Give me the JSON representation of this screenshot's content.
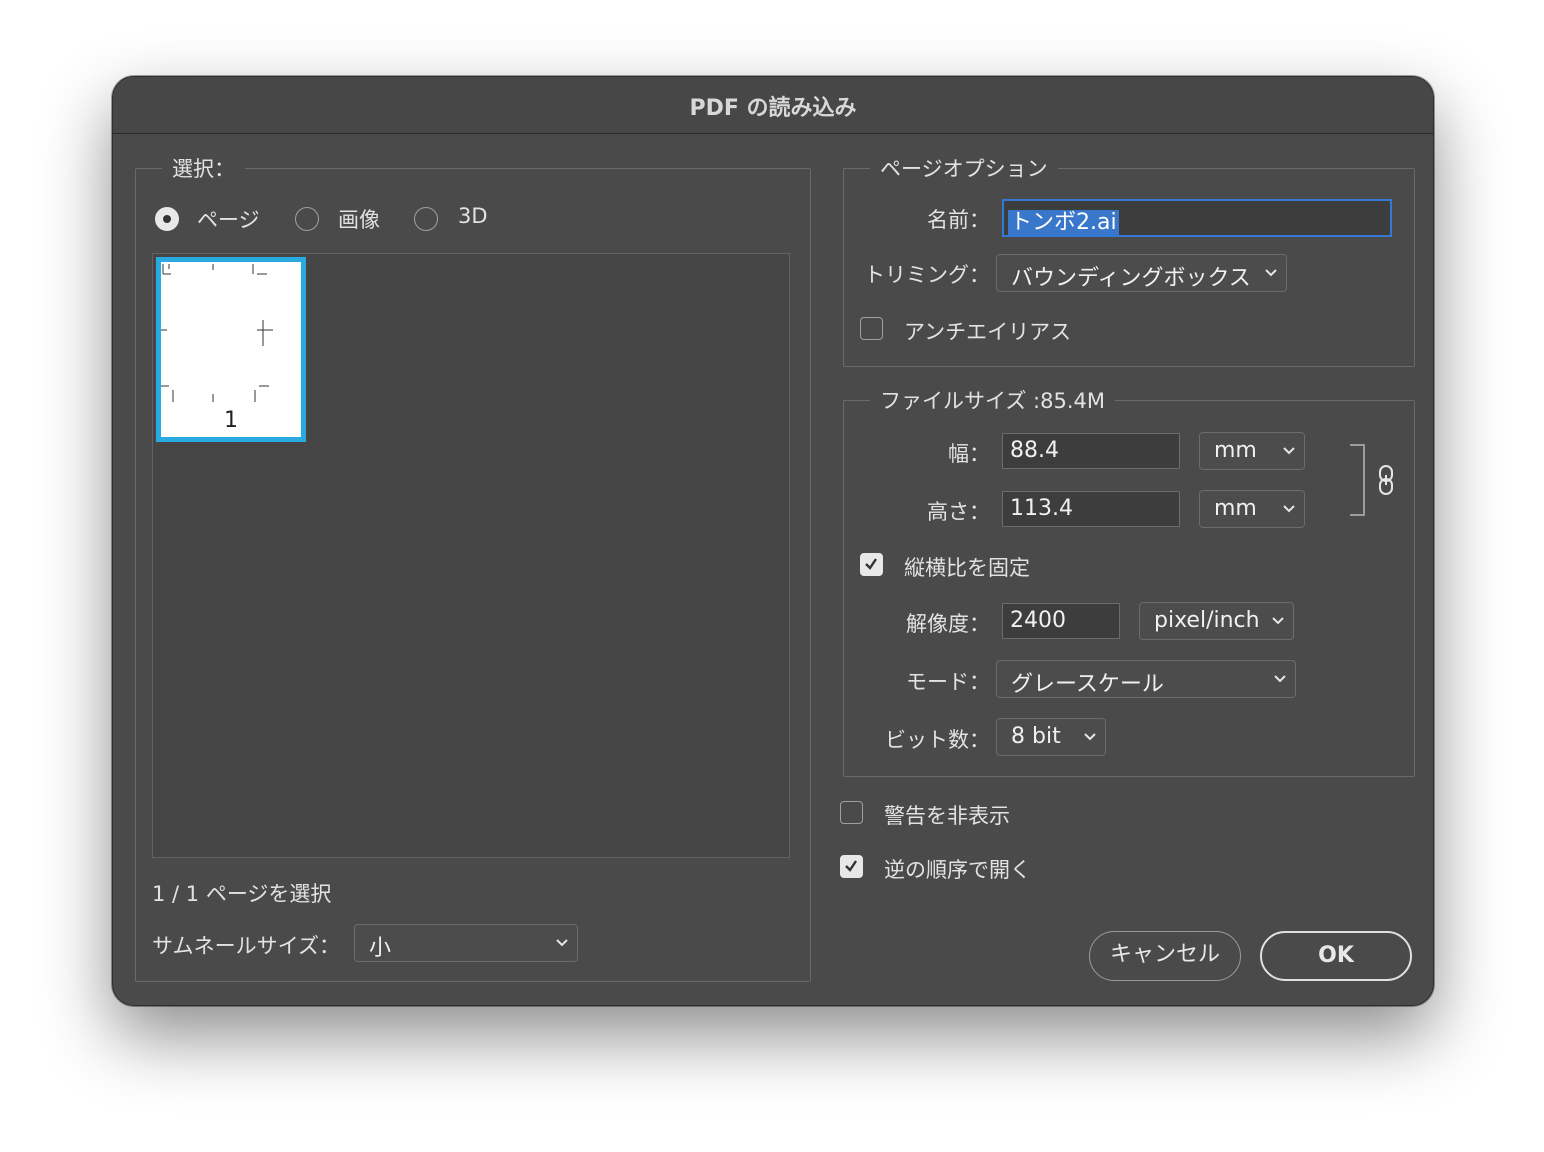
{
  "window": {
    "title": "PDF の読み込み"
  },
  "select_group": {
    "legend": "選択：",
    "radios": [
      {
        "label": "ページ",
        "checked": true
      },
      {
        "label": "画像",
        "checked": false
      },
      {
        "label": "3D",
        "checked": false
      }
    ],
    "thumbnail_page_number": "1",
    "selection_status": "1 / 1 ページを選択",
    "thumbnail_size_label": "サムネールサイズ：",
    "thumbnail_size_value": "小"
  },
  "page_options": {
    "legend": "ページオプション",
    "name_label": "名前：",
    "name_value": "トンボ2.ai",
    "trimming_label": "トリミング：",
    "trimming_value": "バウンディングボックス",
    "antialias_label": "アンチエイリアス",
    "antialias_checked": false
  },
  "file_size": {
    "legend": "ファイルサイズ :85.4M",
    "width_label": "幅：",
    "width_value": "88.4",
    "width_unit": "mm",
    "height_label": "高さ：",
    "height_value": "113.4",
    "height_unit": "mm",
    "constrain_label": "縦横比を固定",
    "constrain_checked": true,
    "resolution_label": "解像度：",
    "resolution_value": "2400",
    "resolution_unit": "pixel/inch",
    "mode_label": "モード：",
    "mode_value": "グレースケール",
    "bits_label": "ビット数：",
    "bits_value": "8 bit"
  },
  "options": {
    "suppress_warnings_label": "警告を非表示",
    "suppress_warnings_checked": false,
    "reverse_order_label": "逆の順序で開く",
    "reverse_order_checked": true
  },
  "buttons": {
    "cancel": "キャンセル",
    "ok": "OK"
  },
  "colors": {
    "dialog_bg": "#4a4a4a",
    "accent_focus": "#3478d6",
    "thumb_border": "#29abe2"
  },
  "icons": {
    "link": "chain-link-icon",
    "chevron": "chevron-down-icon",
    "check": "checkmark-icon"
  }
}
